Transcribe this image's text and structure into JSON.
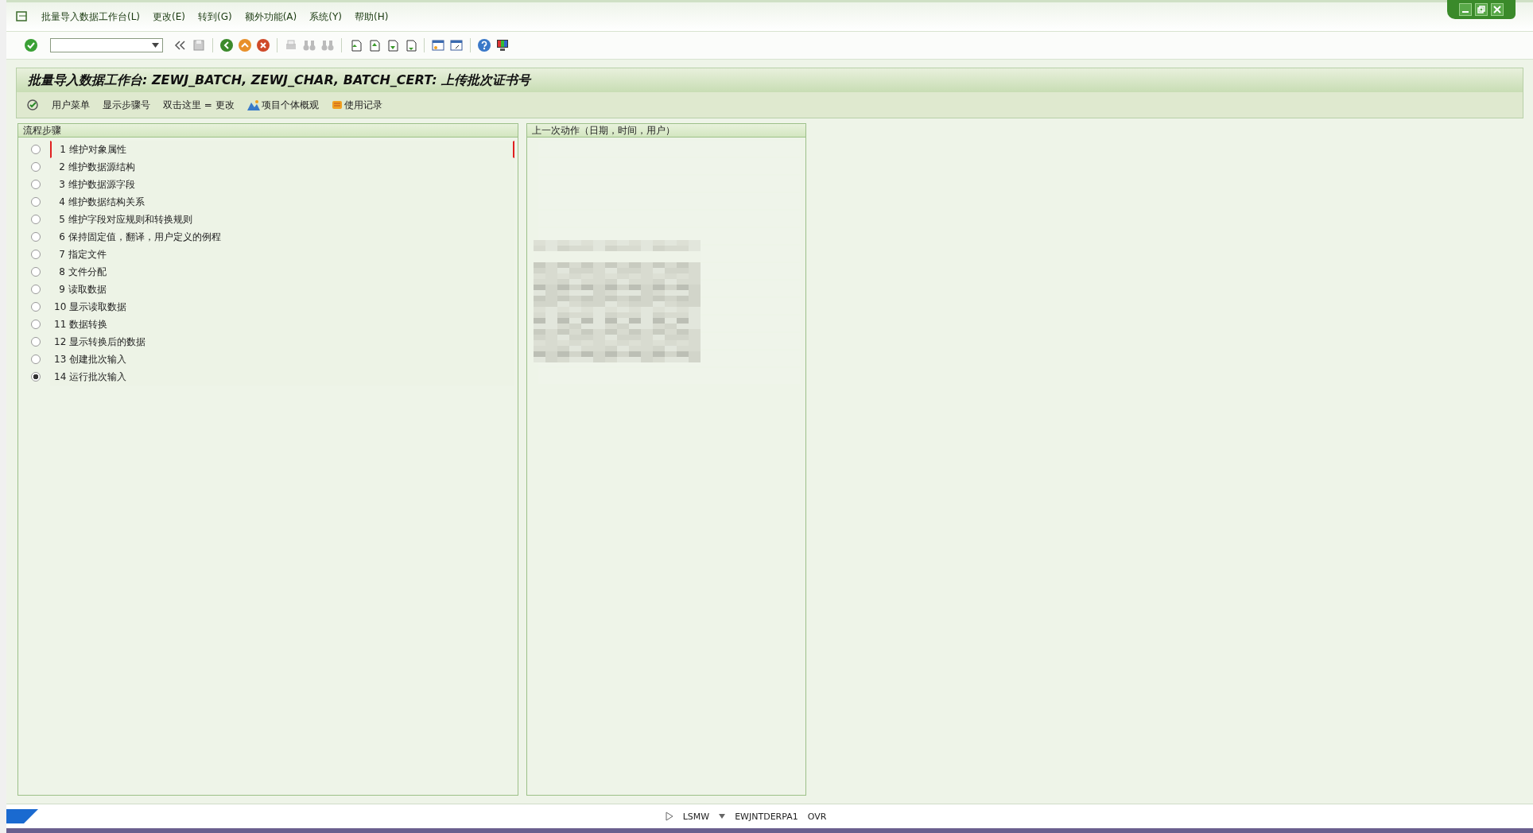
{
  "menu_bar": {
    "items": [
      "批量导入数据工作台(L)",
      "更改(E)",
      "转到(G)",
      "额外功能(A)",
      "系统(Y)",
      "帮助(H)"
    ]
  },
  "title": "批量导入数据工作台: ZEWJ_BATCH, ZEWJ_CHAR, BATCH_CERT: 上传批次证书号",
  "app_toolbar": {
    "items": [
      {
        "kind": "icon"
      },
      {
        "kind": "text",
        "label": "用户菜单"
      },
      {
        "kind": "text",
        "label": "显示步骤号"
      },
      {
        "kind": "text",
        "label": "双击这里 = 更改"
      },
      {
        "kind": "overview",
        "label": "项目个体概观"
      },
      {
        "kind": "log",
        "label": "使用记录"
      }
    ]
  },
  "steps_panel": {
    "header": "流程步骤",
    "steps": [
      {
        "number": "1",
        "label": "维护对象属性",
        "selected": false
      },
      {
        "number": "2",
        "label": "维护数据源结构",
        "selected": false
      },
      {
        "number": "3",
        "label": "维护数据源字段",
        "selected": false
      },
      {
        "number": "4",
        "label": "维护数据结构关系",
        "selected": false
      },
      {
        "number": "5",
        "label": "维护字段对应规则和转换规则",
        "selected": false
      },
      {
        "number": "6",
        "label": "保持固定值，翻译，用户定义的例程",
        "selected": false
      },
      {
        "number": "7",
        "label": "指定文件",
        "selected": false
      },
      {
        "number": "8",
        "label": "文件分配",
        "selected": false
      },
      {
        "number": "9",
        "label": "读取数据",
        "selected": false
      },
      {
        "number": "10",
        "label": "显示读取数据",
        "selected": false
      },
      {
        "number": "11",
        "label": "数据转换",
        "selected": false
      },
      {
        "number": "12",
        "label": "显示转换后的数据",
        "selected": false
      },
      {
        "number": "13",
        "label": "创建批次输入",
        "selected": false
      },
      {
        "number": "14",
        "label": "运行批次输入",
        "selected": true
      }
    ]
  },
  "last_action_panel": {
    "header": "上一次动作（日期，时间，用户）"
  },
  "status_bar": {
    "transaction": "LSMW",
    "server": "EWJNTDERPA1",
    "mode": "OVR"
  }
}
